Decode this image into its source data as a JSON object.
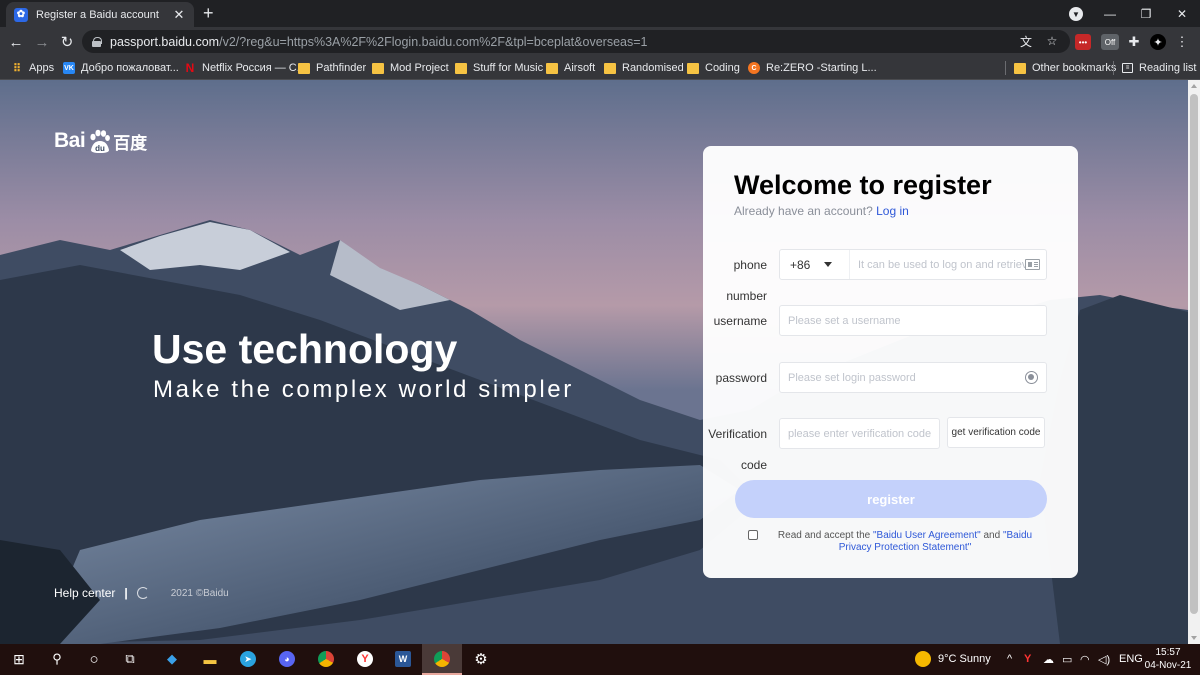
{
  "browser": {
    "tab_title": "Register a Baidu account",
    "url_host": "passport.baidu.com",
    "url_path": "/v2/?reg&u=https%3A%2F%2Flogin.baidu.com%2F&tpl=bceplat&overseas=1",
    "bookmarks": [
      {
        "label": "Apps",
        "icon": "apps-grid-icon"
      },
      {
        "label": "Добро пожалoват...",
        "icon": "vk-icon"
      },
      {
        "label": "Netflix Россия — С...",
        "icon": "netflix-icon"
      },
      {
        "label": "Pathfinder",
        "icon": "folder-icon"
      },
      {
        "label": "Mod Project",
        "icon": "folder-icon"
      },
      {
        "label": "Stuff for Music",
        "icon": "folder-icon"
      },
      {
        "label": "Airsoft",
        "icon": "folder-icon"
      },
      {
        "label": "Randomised",
        "icon": "folder-icon"
      },
      {
        "label": "Coding",
        "icon": "folder-icon"
      },
      {
        "label": "Re:ZERO -Starting L...",
        "icon": "crunchyroll-icon"
      }
    ],
    "other_bookmarks": "Other bookmarks",
    "reading_list": "Reading list",
    "extension_off_badge": "Off"
  },
  "page": {
    "logo_latin": "Bai",
    "logo_du": "du",
    "logo_chinese": "百度",
    "slogan_title": "Use technology",
    "slogan_subtitle": "Make the complex world simpler",
    "help_center": "Help center",
    "footer_sep": "|",
    "copyright": "2021 ©Baidu"
  },
  "form": {
    "heading": "Welcome to register",
    "have_account": "Already have an account?",
    "login_link": "Log in",
    "phone_label_1": "phone",
    "phone_label_2": "number",
    "country_code": "+86",
    "phone_placeholder": "It can be used to log on and retriev",
    "username_label": "username",
    "username_placeholder": "Please set a username",
    "password_label": "password",
    "password_placeholder": "Please set login password",
    "verification_label_1": "Verification",
    "verification_label_2": "code",
    "verification_placeholder": "please enter verification code",
    "get_code_button": "get verification code",
    "register_button": "register",
    "agree_prefix": "Read and accept the ",
    "agree_link_1": "\"Baidu User Agreement\"",
    "agree_and": " and ",
    "agree_link_2": "\"Baidu Privacy Protection Statement\""
  },
  "taskbar": {
    "weather": "9°C  Sunny",
    "language": "ENG",
    "time": "15:57",
    "date": "04-Nov-21"
  },
  "colors": {
    "accent_blue": "#2e58d8",
    "register_button_disabled": "#c4d1fb",
    "taskbar": "#200f0d"
  }
}
